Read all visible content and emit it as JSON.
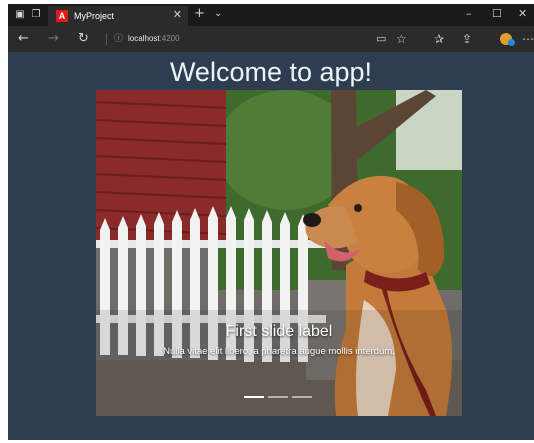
{
  "browser": {
    "tab_favicon": "A",
    "tab_title": "MyProject",
    "tab_close": "✕",
    "new_tab": "+",
    "tab_menu": "⌄",
    "url_host": "localhost",
    "url_port": ":4200",
    "icons": {
      "window_menu": "window-icon",
      "tabs": "tabs-icon",
      "back": "back-arrow-icon",
      "forward": "forward-arrow-icon",
      "refresh": "refresh-icon",
      "site_info": "info-icon",
      "reading": "reading-view-icon",
      "favorite": "star-icon",
      "favorites_hub": "favorites-icon",
      "share": "share-icon",
      "more": "more-icon"
    },
    "window_controls": {
      "minimize": "–",
      "maximize": "☐",
      "close": "✕"
    }
  },
  "page": {
    "heading": "Welcome to app!"
  },
  "carousel": {
    "slide_label": "First slide label",
    "slide_text": "Nulla vitae elit libero, a pharetra augue mollis interdum.",
    "slide_count": 3,
    "active_index": 0,
    "colors": {
      "page_bg": "#2e3e50",
      "browser_chrome": "#2b2b2b",
      "fur": "#c47a3a",
      "collar": "#7b1f1a"
    }
  }
}
